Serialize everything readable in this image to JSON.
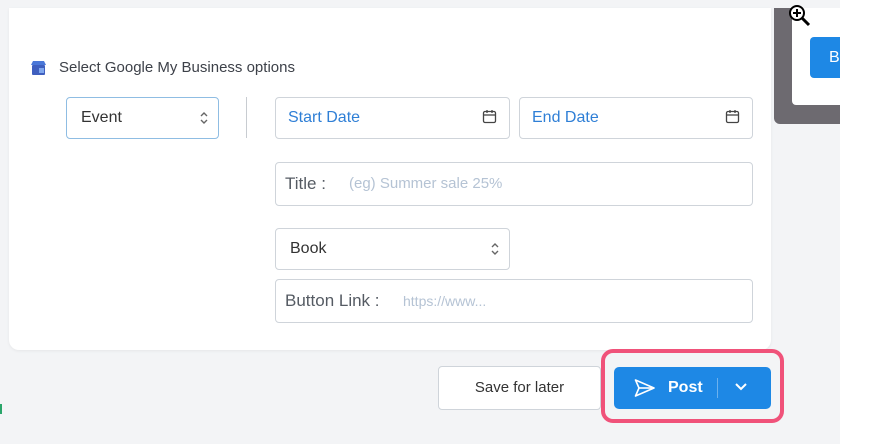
{
  "colors": {
    "accent": "#1e88e5",
    "highlight": "#f0527a",
    "field_label": "#2f7fd6",
    "placeholder": "#b5c3d4"
  },
  "side_panel": {
    "button_label": "B"
  },
  "gmb": {
    "icon": "google-my-business-icon",
    "section_label": "Select Google My Business options",
    "type_select": {
      "value": "Event"
    },
    "start_date": {
      "label": "Start Date",
      "icon": "calendar-icon"
    },
    "end_date": {
      "label": "End Date",
      "icon": "calendar-icon"
    },
    "title_field": {
      "label": "Title :",
      "placeholder": "(eg) Summer sale 25%"
    },
    "button_select": {
      "value": "Book"
    },
    "button_link": {
      "label": "Button Link :",
      "placeholder": "https://www..."
    }
  },
  "footer": {
    "save_for_later": "Save for later",
    "post": "Post",
    "post_icon": "send-icon",
    "dropdown_icon": "chevron-down-icon"
  }
}
